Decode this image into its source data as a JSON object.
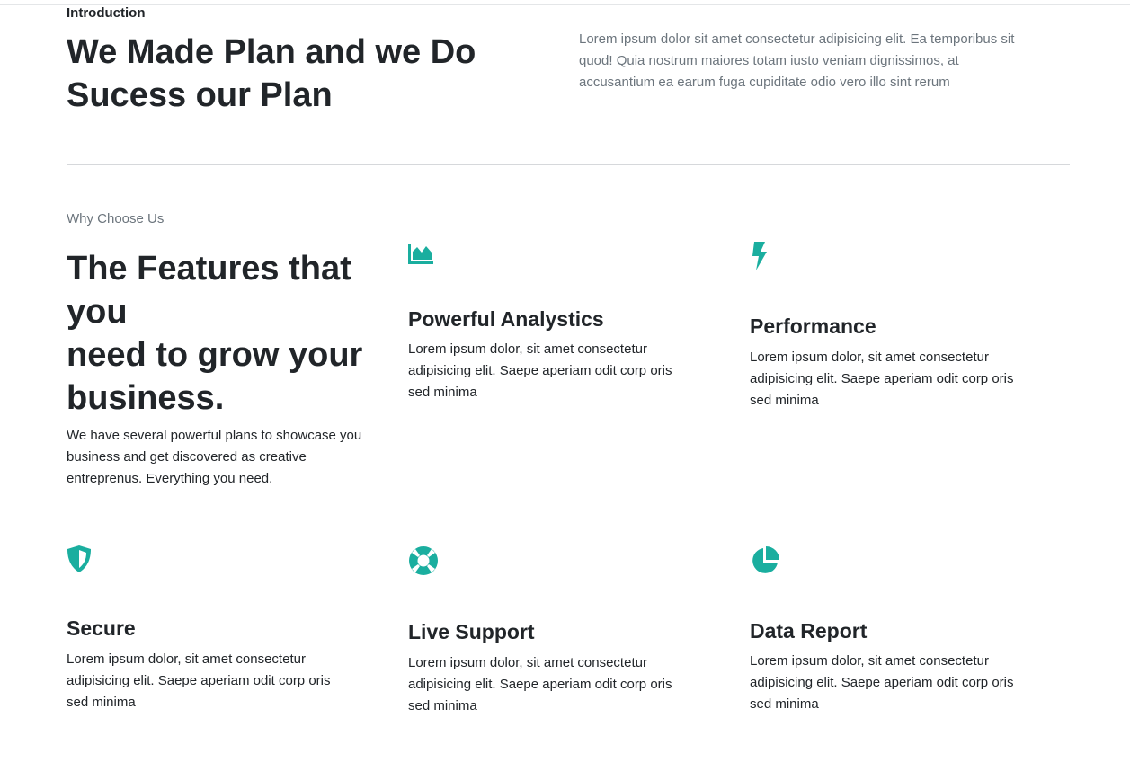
{
  "intro": {
    "label": "Introduction",
    "title": "We Made Plan and we Do Sucess our Plan",
    "text": "Lorem ipsum dolor sit amet consectetur adipisicing elit. Ea temporibus sit quod! Quia nostrum maiores totam iusto veniam dignissimos, at accusantium ea earum fuga cupiditate odio vero illo sint rerum"
  },
  "why": {
    "label": "Why Choose Us",
    "title_lines": [
      "The Features that you",
      "need to grow your business."
    ],
    "text": "We have several powerful plans to showcase you business and get discovered as creative entreprenus. Everything you need."
  },
  "colors": {
    "accent": "#1aae9f",
    "heading": "#212529",
    "muted": "#6c757d"
  },
  "features": [
    {
      "icon": "area-chart-icon",
      "title": "Powerful Analystics",
      "text": "Lorem ipsum dolor, sit amet consectetur adipisicing elit. Saepe aperiam odit corp oris sed minima"
    },
    {
      "icon": "lightning-bolt-icon",
      "title": "Performance",
      "text": "Lorem ipsum dolor, sit amet consectetur adipisicing elit. Saepe aperiam odit corp oris sed minima"
    },
    {
      "icon": "shield-icon",
      "title": "Secure",
      "text": "Lorem ipsum dolor, sit amet consectetur adipisicing elit. Saepe aperiam odit corp oris sed minima"
    },
    {
      "icon": "life-ring-icon",
      "title": "Live Support",
      "text": "Lorem ipsum dolor, sit amet consectetur adipisicing elit. Saepe aperiam odit corp oris sed minima"
    },
    {
      "icon": "pie-chart-icon",
      "title": "Data Report",
      "text": "Lorem ipsum dolor, sit amet consectetur adipisicing elit. Saepe aperiam odit corp oris sed minima"
    }
  ]
}
